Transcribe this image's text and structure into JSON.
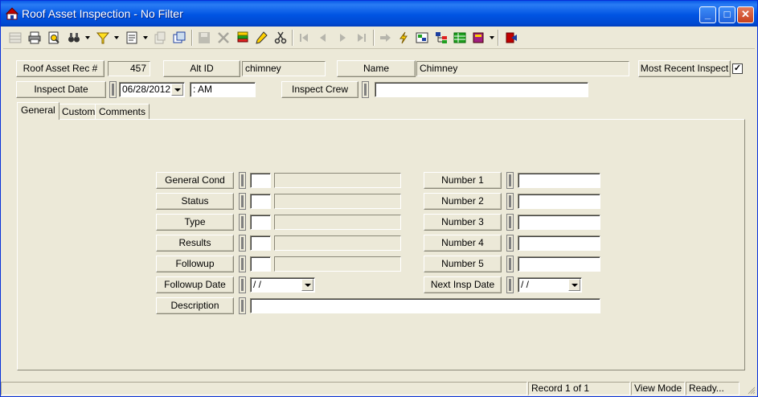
{
  "window": {
    "title": "Roof Asset Inspection - No Filter"
  },
  "header": {
    "rec_label": "Roof Asset Rec #",
    "rec_value": "457",
    "altid_label": "Alt ID",
    "altid_value": "chimney",
    "name_label": "Name",
    "name_value": "Chimney",
    "recent_label": "Most Recent Inspect",
    "recent_checked": "✓",
    "date_label": "Inspect Date",
    "date_value": "06/28/2012",
    "time_value": " :  AM",
    "crew_label": "Inspect Crew",
    "crew_value": ""
  },
  "tabs": [
    {
      "label": "General"
    },
    {
      "label": "Custom"
    },
    {
      "label": "Comments"
    }
  ],
  "general": {
    "left_fields": [
      {
        "label": "General Cond"
      },
      {
        "label": "Status"
      },
      {
        "label": "Type"
      },
      {
        "label": "Results"
      },
      {
        "label": "Followup"
      }
    ],
    "followup_date_label": "Followup Date",
    "followup_date_value": " /  /",
    "description_label": "Description",
    "description_value": "",
    "right_fields": [
      {
        "label": "Number 1"
      },
      {
        "label": "Number 2"
      },
      {
        "label": "Number 3"
      },
      {
        "label": "Number 4"
      },
      {
        "label": "Number 5"
      }
    ],
    "next_insp_label": "Next Insp Date",
    "next_insp_value": " /  /"
  },
  "status": {
    "record": "Record 1 of 1",
    "mode": "View Mode",
    "state": "Ready..."
  }
}
